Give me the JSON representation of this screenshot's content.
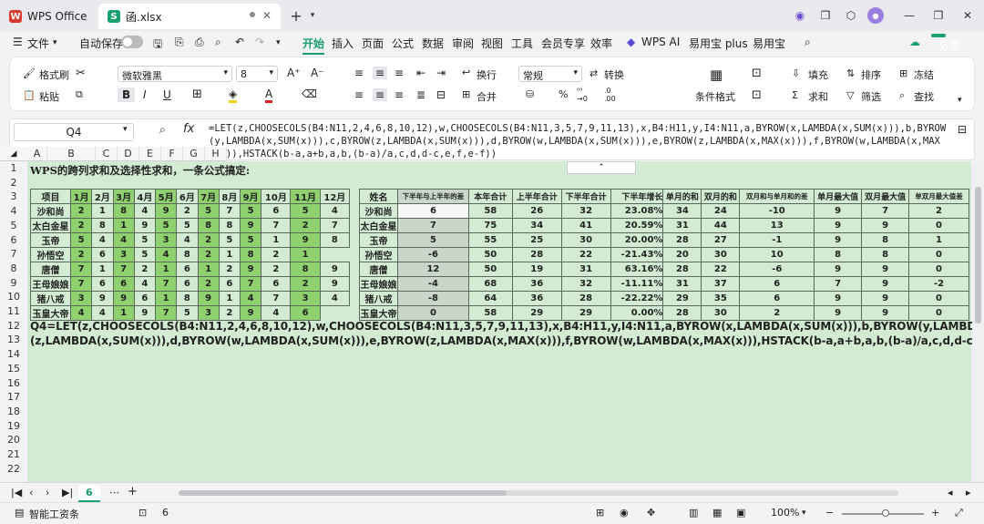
{
  "tabs": {
    "home": "WPS Office",
    "file": "函.xlsx"
  },
  "menu": {
    "file": "文件",
    "autosave": "自动保存",
    "items": [
      "开始",
      "插入",
      "页面",
      "公式",
      "数据",
      "审阅",
      "视图",
      "工具",
      "会员专享",
      "效率"
    ],
    "wps_ai": "WPS AI",
    "easy_plus": "易用宝 plus",
    "easy": "易用宝",
    "share": "分享"
  },
  "ribbon": {
    "format_painter": "格式刷",
    "paste": "粘贴",
    "font_name": "微软雅黑",
    "font_size": "8",
    "wrap": "换行",
    "merge": "合并",
    "number_format": "常规",
    "convert": "转换",
    "cond_format": "条件格式",
    "fill": "填充",
    "sort": "排序",
    "freeze": "冻结",
    "sum": "求和",
    "filter": "筛选",
    "find": "查找"
  },
  "formula_bar": {
    "cell": "Q4",
    "fx": "fx",
    "formula": "=LET(z,CHOOSECOLS(B4:N11,2,4,6,8,10,12),w,CHOOSECOLS(B4:N11,3,5,7,9,11,13),x,B4:H11,y,I4:N11,a,BYROW(x,LAMBDA(x,SUM(x))),b,BYROW(y,LAMBDA(x,SUM(x))),c,BYROW(z,LAMBDA(x,SUM(x))),d,BYROW(w,LAMBDA(x,SUM(x))),e,BYROW(z,LAMBDA(x,MAX(x))),f,BYROW(w,LAMBDA(x,MAX(x))),HSTACK(b-a,a+b,a,b,(b-a)/a,c,d,d-c,e,f,e-f))"
  },
  "columns": [
    "A",
    "B",
    "C",
    "D",
    "E",
    "F",
    "G",
    "H"
  ],
  "rows": [
    "1",
    "2",
    "3",
    "4",
    "5",
    "6",
    "7",
    "8",
    "9",
    "10",
    "11",
    "12",
    "13",
    "14",
    "15",
    "16",
    "17",
    "18",
    "19",
    "20",
    "21",
    "22"
  ],
  "title": "WPS的跨列求和及选择性求和，一条公式搞定:",
  "left_table": {
    "headers": [
      "项目",
      "1月",
      "2月",
      "3月",
      "4月",
      "5月",
      "6月",
      "7月",
      "8月",
      "9月",
      "10月",
      "11月",
      "12月"
    ],
    "rows": [
      [
        "沙和尚",
        "2",
        "1",
        "8",
        "4",
        "9",
        "2",
        "5",
        "7",
        "5",
        "6",
        "5",
        "4"
      ],
      [
        "太白金星",
        "2",
        "8",
        "1",
        "9",
        "5",
        "5",
        "8",
        "8",
        "9",
        "7",
        "2",
        "7"
      ],
      [
        "玉帝",
        "5",
        "4",
        "4",
        "5",
        "3",
        "4",
        "2",
        "5",
        "5",
        "1",
        "9",
        "8"
      ],
      [
        "孙悟空",
        "2",
        "6",
        "3",
        "5",
        "4",
        "8",
        "2",
        "1",
        "8",
        "2",
        "1"
      ],
      [
        "唐僧",
        "7",
        "1",
        "7",
        "2",
        "1",
        "6",
        "1",
        "2",
        "9",
        "2",
        "8",
        "9"
      ],
      [
        "王母娘娘",
        "7",
        "6",
        "6",
        "4",
        "7",
        "6",
        "2",
        "6",
        "7",
        "6",
        "2",
        "9"
      ],
      [
        "猪八戒",
        "3",
        "9",
        "9",
        "6",
        "1",
        "8",
        "9",
        "1",
        "4",
        "7",
        "3",
        "4"
      ],
      [
        "玉皇大帝",
        "4",
        "4",
        "1",
        "9",
        "7",
        "5",
        "3",
        "2",
        "9",
        "4",
        "6"
      ]
    ]
  },
  "right_table": {
    "headers": [
      "姓名",
      "下半年与上半年的差",
      "本年合计",
      "上半年合计",
      "下半年合计",
      "下半年增长",
      "单月的和",
      "双月的和",
      "双月和与单月和的差",
      "单月最大值",
      "双月最大值",
      "单双月最大值差"
    ],
    "rows": [
      [
        "沙和尚",
        "6",
        "58",
        "26",
        "32",
        "23.08%",
        "34",
        "24",
        "-10",
        "9",
        "7",
        "2"
      ],
      [
        "太白金星",
        "7",
        "75",
        "34",
        "41",
        "20.59%",
        "31",
        "44",
        "13",
        "9",
        "9",
        "0"
      ],
      [
        "玉帝",
        "5",
        "55",
        "25",
        "30",
        "20.00%",
        "28",
        "27",
        "-1",
        "9",
        "8",
        "1"
      ],
      [
        "孙悟空",
        "-6",
        "50",
        "28",
        "22",
        "-21.43%",
        "20",
        "30",
        "10",
        "8",
        "8",
        "0"
      ],
      [
        "唐僧",
        "12",
        "50",
        "19",
        "31",
        "63.16%",
        "28",
        "22",
        "-6",
        "9",
        "9",
        "0"
      ],
      [
        "王母娘娘",
        "-4",
        "68",
        "36",
        "32",
        "-11.11%",
        "31",
        "37",
        "6",
        "7",
        "9",
        "-2"
      ],
      [
        "猪八戒",
        "-8",
        "64",
        "36",
        "28",
        "-22.22%",
        "29",
        "35",
        "6",
        "9",
        "9",
        "0"
      ],
      [
        "玉皇大帝",
        "0",
        "58",
        "29",
        "29",
        "0.00%",
        "28",
        "30",
        "2",
        "9",
        "9",
        "0"
      ]
    ]
  },
  "formula_text_line1": "Q4=LET(z,CHOOSECOLS(B4:N11,2,4,6,8,10,12),w,CHOOSECOLS(B4:N11,3,5,7,9,11,13),x,B4:H11,y,I4:N11,a,BYROW(x,LAMBDA(x,SUM(x))),b,BYROW(y,LAMBDA(x,SUM(x))),c,BYROW",
  "formula_text_line2": "(z,LAMBDA(x,SUM(x))),d,BYROW(w,LAMBDA(x,SUM(x))),e,BYROW(z,LAMBDA(x,MAX(x))),f,BYROW(w,LAMBDA(x,MAX(x))),HSTACK(b-a,a+b,a,b,(b-a)/a,c,d,d-c,e,f,e-f)。不用复制。",
  "sheet_tab": "6",
  "status": {
    "workbook": "智能工资条",
    "value": "6",
    "zoom": "100%"
  }
}
